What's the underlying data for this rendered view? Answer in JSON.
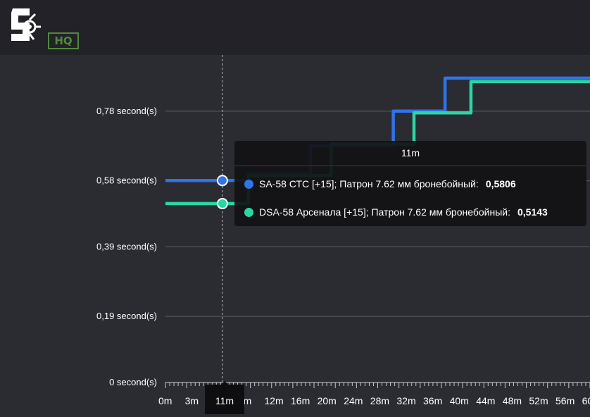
{
  "chart_data": {
    "type": "line",
    "step": true,
    "x_unit": "m",
    "x_ticks": [
      "0m",
      "3m",
      "6m",
      "9m",
      "12m",
      "16m",
      "20m",
      "24m",
      "28m",
      "32m",
      "36m",
      "40m",
      "44m",
      "48m",
      "52m",
      "56m",
      "60m",
      "64m",
      "68m",
      "72m",
      "76m",
      "80m"
    ],
    "y_ticks": [
      {
        "value": 0,
        "label": "0 second(s)"
      },
      {
        "value": 0.19,
        "label": "0,19 second(s)"
      },
      {
        "value": 0.39,
        "label": "0,39 second(s)"
      },
      {
        "value": 0.58,
        "label": "0,58 second(s)"
      },
      {
        "value": 0.78,
        "label": "0,78 second(s)"
      }
    ],
    "ylim": [
      0,
      0.97
    ],
    "xlim": [
      0,
      82
    ],
    "grid": true,
    "series": [
      {
        "name": "SA-58 СТС [+15]; Патрон 7.62 мм бронебойный",
        "color": "#2f74e8",
        "points": [
          [
            0,
            0.5806
          ],
          [
            16,
            0.5806
          ],
          [
            16,
            0.6
          ],
          [
            28,
            0.6
          ],
          [
            28,
            0.68
          ],
          [
            44,
            0.68
          ],
          [
            44,
            0.78
          ],
          [
            54,
            0.78
          ],
          [
            54,
            0.875
          ],
          [
            82,
            0.875
          ]
        ]
      },
      {
        "name": "DSA-58 Арсенала [+15]; Патрон 7.62 мм бронебойный",
        "color": "#2ad6a2",
        "points": [
          [
            0,
            0.5143
          ],
          [
            16,
            0.5143
          ],
          [
            16,
            0.595
          ],
          [
            32,
            0.595
          ],
          [
            32,
            0.685
          ],
          [
            48,
            0.685
          ],
          [
            48,
            0.775
          ],
          [
            59,
            0.775
          ],
          [
            59,
            0.865
          ],
          [
            82,
            0.865
          ]
        ]
      }
    ],
    "hover": {
      "x": 11,
      "x_label": "11m",
      "values": [
        {
          "label": "SA-58 СТС [+15]; Патрон 7.62 мм бронебойный:",
          "value": "0,5806"
        },
        {
          "label": "DSA-58 Арсенала [+15]; Патрон 7.62 мм бронебойный:",
          "value": "0,5143"
        }
      ]
    }
  },
  "logo": {
    "text": "HQ"
  }
}
